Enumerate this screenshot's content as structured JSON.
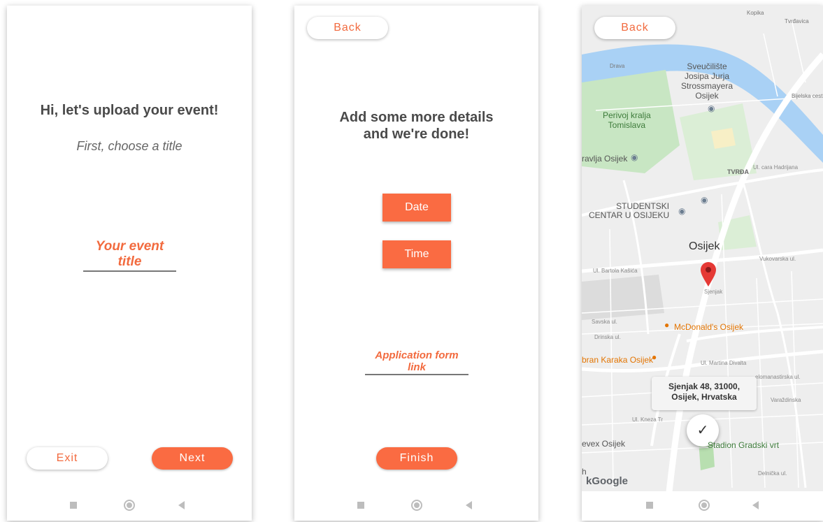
{
  "screen1": {
    "heading": "Hi, let's upload your event!",
    "subtitle": "First, choose a title",
    "title_field": "Your event title",
    "exit_label": "Exit",
    "next_label": "Next"
  },
  "screen2": {
    "back_label": "Back",
    "heading_line1": "Add some more details",
    "heading_line2": "and we're done!",
    "date_label": "Date",
    "time_label": "Time",
    "link_field": "Application form link",
    "finish_label": "Finish"
  },
  "screen3": {
    "back_label": "Back",
    "map_labels": {
      "university": [
        "Sveučilište",
        "Josipa Jurja",
        "Strossmayera",
        "Osijek"
      ],
      "park": [
        "Perivoj kralja",
        "Tomislava"
      ],
      "ravlja": "ravlja Osijek",
      "tvrda": "TVRĐA",
      "cara": "Ul. cara Hadrijana",
      "student": [
        "STUDENTSKI",
        "CENTAR U OSIJEKU"
      ],
      "city": "Osijek",
      "vukovarska": "Vukovarska ul.",
      "bartola": "Ul. Bartola Kašića",
      "sjenjak": "Sjenjak",
      "mcdonalds": "McDonald's Osijek",
      "savska": "Savska ul.",
      "drinska": "Drinska ul.",
      "karaka": "bran Karaka Osijek",
      "martina": "Ul. Martina Divalta",
      "solomanastirska": "elomanastirska ul.",
      "kneza": "Ul. Kneza Tr",
      "stadion": "Stadion Gradski vrt",
      "evex": "evex Osijek",
      "delnicka": "Delnička ul.",
      "drava": "Drava",
      "bijelska": "Bijelska cesta",
      "tvrdavica": "Tvrđavica",
      "kopika": "Kopika",
      "varazdinska": "Varaždinska",
      "h_letter": "h"
    },
    "address_line1": "Sjenjak 48, 31000,",
    "address_line2": "Osijek, Hrvatska",
    "confirm_symbol": "✓",
    "google_logo": "kGoogle"
  },
  "colors": {
    "accent": "#fa6b42",
    "accent_text": "#f26a3e"
  },
  "icons": {
    "nav_recent": "square-icon",
    "nav_home": "circle-icon",
    "nav_back": "triangle-back-icon"
  }
}
